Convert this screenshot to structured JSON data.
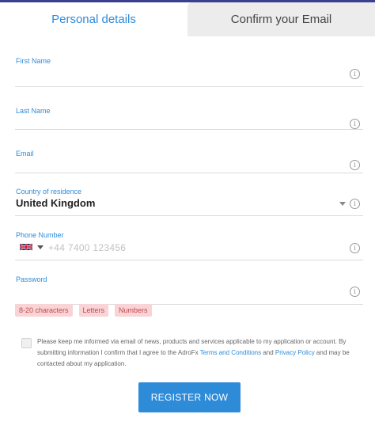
{
  "tabs": {
    "personal": "Personal details",
    "confirm": "Confirm your Email"
  },
  "fields": {
    "first_name": {
      "label": "First Name"
    },
    "last_name": {
      "label": "Last Name"
    },
    "email": {
      "label": "Email"
    },
    "country": {
      "label": "Country of residence",
      "value": "United Kingdom"
    },
    "phone": {
      "label": "Phone Number",
      "placeholder": "+44 7400 123456",
      "flag": "uk-flag-icon"
    },
    "password": {
      "label": "Password"
    }
  },
  "password_rules": [
    "8-20 characters",
    "Letters",
    "Numbers"
  ],
  "consent": {
    "text_before": "Please keep me informed via email of news, products and services applicable to my application or account. By submitting information I confirm that I agree to the AdroFx ",
    "terms_link": "Terms and Conditions",
    "text_and": " and ",
    "privacy_link": "Privacy Policy",
    "text_after": " and may be contacted about my application."
  },
  "register_button": "REGISTER NOW",
  "colors": {
    "accent": "#2d8bd8",
    "chip_bg": "#f9d4d6",
    "chip_text": "#c04950",
    "inactive_tab": "#ececec"
  }
}
